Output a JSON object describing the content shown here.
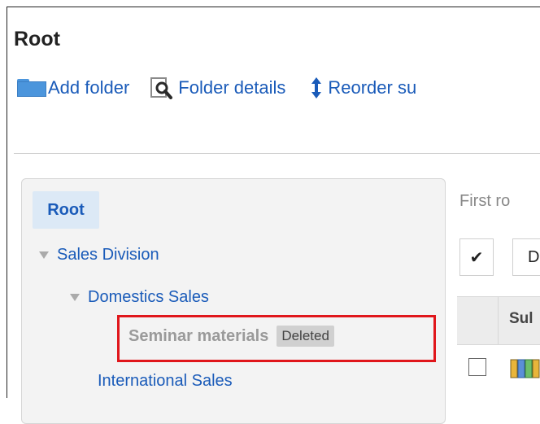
{
  "page": {
    "title": "Root"
  },
  "toolbar": {
    "add_folder": "Add folder",
    "folder_details": "Folder details",
    "reorder": "Reorder su"
  },
  "tree": {
    "root": "Root",
    "items": [
      {
        "label": "Sales Division",
        "expanded": true
      },
      {
        "label": "Domestics Sales",
        "expanded": true
      },
      {
        "label": "Seminar materials",
        "badge": "Deleted"
      },
      {
        "label": "International Sales"
      }
    ]
  },
  "content": {
    "first_row_text": "First ro",
    "check_button": "✔",
    "d_button": "D",
    "column_header": "Sul"
  },
  "colors": {
    "link": "#1a5bb9",
    "highlight_border": "#e0161b",
    "folder_blue": "#4b95dc"
  }
}
